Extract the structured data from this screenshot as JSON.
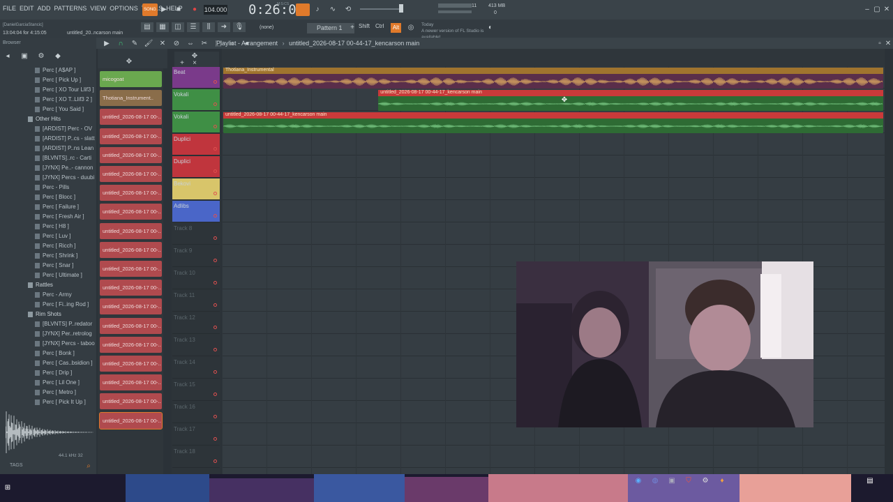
{
  "menu": [
    "FILE",
    "EDIT",
    "ADD",
    "PATTERNS",
    "VIEW",
    "OPTIONS",
    "TOOLS",
    "HELP"
  ],
  "transport": {
    "song_label": "SONG",
    "bpm": "104.000",
    "time": "0:26:07",
    "msec_label": "M:S:CS",
    "cpu": "11",
    "memory": "413 MB",
    "polyphony": "0"
  },
  "hint": {
    "user": "[DanielGarciaStancic]",
    "time": "13:04:04 for 4:15:05",
    "file": "untitled_20..ncarson main"
  },
  "toolbar2": {
    "none_label": "(none)",
    "pattern": "Pattern 1",
    "shift": "Shift",
    "ctrl": "Ctrl",
    "alt": "Alt",
    "news_day": "Today",
    "news": "A newer version of FL Studio is available!"
  },
  "browser": {
    "title": "Browser",
    "items": [
      {
        "label": "Perc [ A$AP ]",
        "type": "file"
      },
      {
        "label": "Perc [ Pick Up ]",
        "type": "file"
      },
      {
        "label": "Perc [ XO Tour Llif3 ]",
        "type": "file"
      },
      {
        "label": "Perc [ XO T..Llif3 2 ]",
        "type": "file"
      },
      {
        "label": "Perc [ You Said ]",
        "type": "file"
      },
      {
        "label": "Other Hits",
        "type": "folder"
      },
      {
        "label": "[ARDIST] Perc - OV",
        "type": "file"
      },
      {
        "label": "[ARDIST] P..cs - slatt",
        "type": "file"
      },
      {
        "label": "[ARDIST] P..ns Lean",
        "type": "file"
      },
      {
        "label": "[BLVNTS]..rc - Carti",
        "type": "file"
      },
      {
        "label": "[JYNX] Pe..- cannon",
        "type": "file"
      },
      {
        "label": "[JYNX] Percs - duubi",
        "type": "file"
      },
      {
        "label": "Perc - Pills",
        "type": "file"
      },
      {
        "label": "Perc [ Blocc ]",
        "type": "file"
      },
      {
        "label": "Perc [ Failure ]",
        "type": "file"
      },
      {
        "label": "Perc [ Fresh Air ]",
        "type": "file"
      },
      {
        "label": "Perc [ H8 ]",
        "type": "file"
      },
      {
        "label": "Perc [ Luv ]",
        "type": "file"
      },
      {
        "label": "Perc [ Ricch ]",
        "type": "file"
      },
      {
        "label": "Perc [ Shrink ]",
        "type": "file"
      },
      {
        "label": "Perc [ Snar ]",
        "type": "file"
      },
      {
        "label": "Perc [ Ultimate ]",
        "type": "file"
      },
      {
        "label": "Rattles",
        "type": "folder"
      },
      {
        "label": "Perc - Army",
        "type": "file"
      },
      {
        "label": "Perc [ Fi..ing Rod ]",
        "type": "file"
      },
      {
        "label": "Rim Shots",
        "type": "folder"
      },
      {
        "label": "[BLVNTS] P..redator",
        "type": "file"
      },
      {
        "label": "[JYNX] Per..retrolog",
        "type": "file"
      },
      {
        "label": "[JYNX] Percs - taboo",
        "type": "file"
      },
      {
        "label": "Perc [ Bonk ]",
        "type": "file"
      },
      {
        "label": "Perc [ Cas..bsidion ]",
        "type": "file"
      },
      {
        "label": "Perc [ Drip ]",
        "type": "file"
      },
      {
        "label": "Perc [ Lil One ]",
        "type": "file"
      },
      {
        "label": "Perc [ Metro ]",
        "type": "file"
      },
      {
        "label": "Perc [ Pick It Up ]",
        "type": "file"
      }
    ],
    "sample_rate": "44.1 kHz 32",
    "tags": "TAGS"
  },
  "channels": [
    {
      "label": "micogoat",
      "color": "#6aa84f"
    },
    {
      "label": "Thotiana_Instrument..",
      "color": "#8a6d4a"
    },
    {
      "label": "untitled_2026-08-17 00-..",
      "color": "#b04a4e"
    },
    {
      "label": "untitled_2026-08-17 00-..",
      "color": "#b04a4e"
    },
    {
      "label": "untitled_2026-08-17 00-..",
      "color": "#b04a4e"
    },
    {
      "label": "untitled_2026-08-17 00-..",
      "color": "#b04a4e"
    },
    {
      "label": "untitled_2026-08-17 00-..",
      "color": "#b04a4e"
    },
    {
      "label": "untitled_2026-08-17 00-..",
      "color": "#b04a4e"
    },
    {
      "label": "untitled_2026-08-17 00-..",
      "color": "#b04a4e"
    },
    {
      "label": "untitled_2026-08-17 00-..",
      "color": "#b04a4e"
    },
    {
      "label": "untitled_2026-08-17 00-..",
      "color": "#b04a4e"
    },
    {
      "label": "untitled_2026-08-17 00-..",
      "color": "#b04a4e"
    },
    {
      "label": "untitled_2026-08-17 00-..",
      "color": "#b04a4e"
    },
    {
      "label": "untitled_2026-08-17 00-..",
      "color": "#b04a4e"
    },
    {
      "label": "untitled_2026-08-17 00-..",
      "color": "#b04a4e"
    },
    {
      "label": "untitled_2026-08-17 00-..",
      "color": "#b04a4e"
    },
    {
      "label": "untitled_2026-08-17 00-..",
      "color": "#b04a4e"
    },
    {
      "label": "untitled_2026-08-17 00-..",
      "color": "#b04a4e"
    },
    {
      "label": "untitled_2026-08-17 00-..",
      "color": "#b04a4e"
    }
  ],
  "playlist": {
    "title": "Playlist - Arrangement",
    "file": "untitled_2026-08-17 00-44-17_kencarson main"
  },
  "tracks": [
    {
      "label": "Beat",
      "color": "#7a3a8a"
    },
    {
      "label": "Vokali",
      "color": "#3f8f45"
    },
    {
      "label": "Vokali",
      "color": "#3f8f45"
    },
    {
      "label": "Duplici",
      "color": "#c0353d"
    },
    {
      "label": "Duplici",
      "color": "#c0353d"
    },
    {
      "label": "Bekovi",
      "color": "#d8c56a"
    },
    {
      "label": "Adlibs",
      "color": "#4a66c8"
    },
    {
      "label": "Track 8",
      "color": ""
    },
    {
      "label": "Track 9",
      "color": ""
    },
    {
      "label": "Track 10",
      "color": ""
    },
    {
      "label": "Track 11",
      "color": ""
    },
    {
      "label": "Track 12",
      "color": ""
    },
    {
      "label": "Track 13",
      "color": ""
    },
    {
      "label": "Track 14",
      "color": ""
    },
    {
      "label": "Track 15",
      "color": ""
    },
    {
      "label": "Track 16",
      "color": ""
    },
    {
      "label": "Track 17",
      "color": ""
    },
    {
      "label": "Track 18",
      "color": ""
    }
  ],
  "clips": [
    {
      "track": 0,
      "label": "Thotiana_Instrumental",
      "start": 0.0,
      "end": 1.0,
      "color": "#a0742e",
      "bg": "#5a2e4a"
    },
    {
      "track": 1,
      "label": "untitled_2026-08-17 00-44-17_kencarson main",
      "start": 0.235,
      "end": 1.0,
      "color": "#c93a3a",
      "bg": "#2e6b34"
    },
    {
      "track": 2,
      "label": "untitled_2026-08-17 00-44-17_kencarson main",
      "start": 0.0,
      "end": 1.0,
      "color": "#c93a3a",
      "bg": "#2e6b34"
    }
  ]
}
